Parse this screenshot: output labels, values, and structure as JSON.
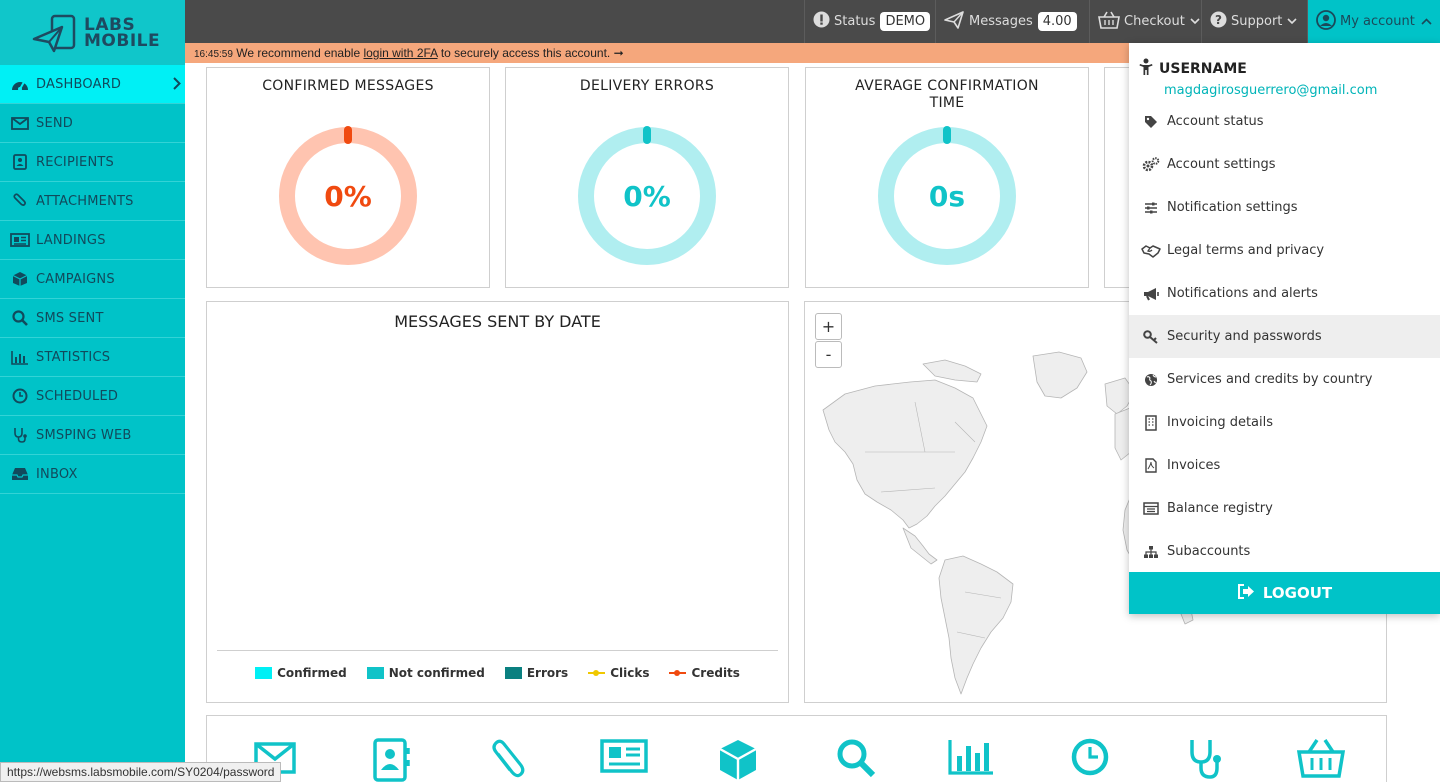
{
  "logo": {
    "line1": "LABS",
    "line2": "MOBILE"
  },
  "sidebar": {
    "items": [
      {
        "label": "DASHBOARD",
        "icon": "dashboard-icon",
        "active": true
      },
      {
        "label": "SEND",
        "icon": "envelope-icon"
      },
      {
        "label": "RECIPIENTS",
        "icon": "address-book-icon"
      },
      {
        "label": "ATTACHMENTS",
        "icon": "paperclip-icon"
      },
      {
        "label": "LANDINGS",
        "icon": "newspaper-icon"
      },
      {
        "label": "CAMPAIGNS",
        "icon": "cube-icon"
      },
      {
        "label": "SMS SENT",
        "icon": "search-icon"
      },
      {
        "label": "STATISTICS",
        "icon": "bar-chart-icon"
      },
      {
        "label": "SCHEDULED",
        "icon": "clock-icon"
      },
      {
        "label": "SMSPING WEB",
        "icon": "stethoscope-icon"
      },
      {
        "label": "INBOX",
        "icon": "inbox-icon"
      }
    ]
  },
  "topbar": {
    "status_label": "Status",
    "status_value": "DEMO",
    "messages_label": "Messages",
    "messages_value": "4.00",
    "checkout_label": "Checkout",
    "support_label": "Support",
    "account_label": "My account"
  },
  "warning": {
    "time": "16:45:59",
    "text_before": " We recommend enable ",
    "link": "login with 2FA",
    "text_after": " to securely access this account. ➞"
  },
  "cards": [
    {
      "title": "CONFIRMED MESSAGES",
      "value": "0%",
      "color": "#f04a10",
      "track": "#ffc4b0"
    },
    {
      "title": "DELIVERY ERRORS",
      "value": "0%",
      "color": "#10c3c8",
      "track": "#b0eef0"
    },
    {
      "title": "AVERAGE CONFIRMATION TIME",
      "value": "0s",
      "color": "#10c3c8",
      "track": "#b0eef0"
    }
  ],
  "chart": {
    "title": "MESSAGES SENT BY DATE",
    "legend": [
      {
        "label": "Confirmed",
        "color": "#00f0f5",
        "type": "box"
      },
      {
        "label": "Not confirmed",
        "color": "#10c3c8",
        "type": "box"
      },
      {
        "label": "Errors",
        "color": "#0a8080",
        "type": "box"
      },
      {
        "label": "Clicks",
        "color": "#f0c800",
        "type": "line"
      },
      {
        "label": "Credits",
        "color": "#f04a10",
        "type": "line"
      }
    ]
  },
  "map": {
    "zoom_in": "+",
    "zoom_out": "-"
  },
  "dropdown": {
    "username": "USERNAME",
    "email": "magdagirosguerrero@gmail.com",
    "items": [
      {
        "label": "Account status",
        "icon": "tag-icon"
      },
      {
        "label": "Account settings",
        "icon": "cogs-icon"
      },
      {
        "label": "Notification settings",
        "icon": "sliders-icon"
      },
      {
        "label": "Legal terms and privacy",
        "icon": "handshake-icon"
      },
      {
        "label": "Notifications and alerts",
        "icon": "megaphone-icon"
      },
      {
        "label": "Security and passwords",
        "icon": "key-icon"
      },
      {
        "label": "Services and credits by country",
        "icon": "globe-icon"
      },
      {
        "label": "Invoicing details",
        "icon": "building-icon"
      },
      {
        "label": "Invoices",
        "icon": "pdf-file-icon"
      },
      {
        "label": "Balance registry",
        "icon": "list-icon"
      },
      {
        "label": "Subaccounts",
        "icon": "sitemap-icon"
      }
    ],
    "logout": "LOGOUT"
  },
  "status_url": "https://websms.labsmobile.com/SY0204/password"
}
